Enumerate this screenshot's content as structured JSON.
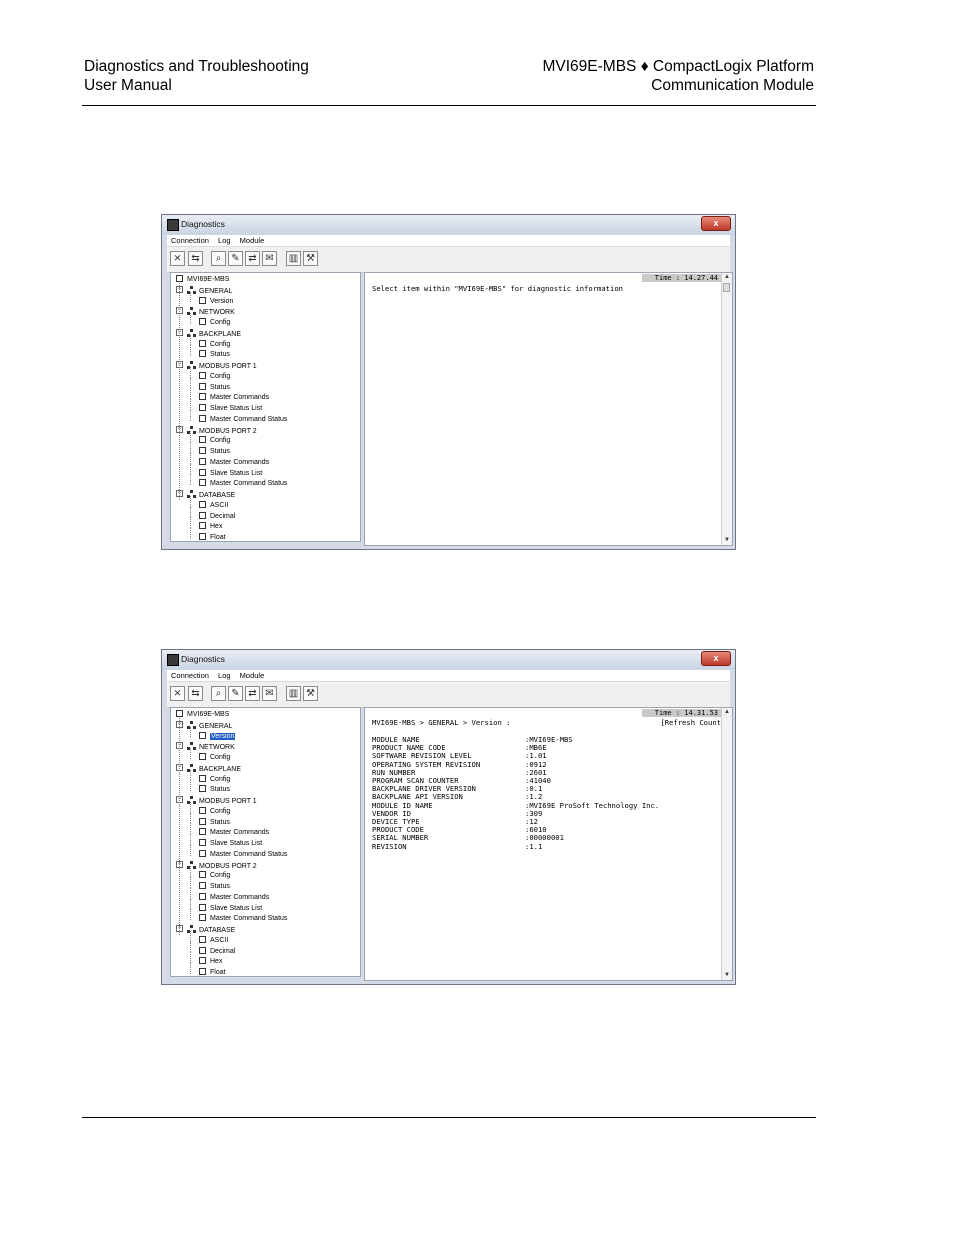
{
  "header": {
    "left_line1": "Diagnostics and Troubleshooting",
    "left_line2": "User Manual",
    "right_line1": "MVI69E-MBS ♦ CompactLogix Platform",
    "right_line2": "Communication Module"
  },
  "window": {
    "title": "Diagnostics",
    "close_symbol": "x",
    "menu": [
      "Connection",
      "Log",
      "Module"
    ]
  },
  "toolbar_icons": [
    "disconnect-icon",
    "connect-icon",
    "zoom-icon",
    "edit-icon",
    "transfer-icon",
    "mail-icon",
    "chart-icon",
    "tools-icon"
  ],
  "tree": [
    {
      "label": "MVI69E-MBS",
      "level": 0,
      "kind": "root"
    },
    {
      "label": "GENERAL",
      "level": 1,
      "kind": "group"
    },
    {
      "label": "Version",
      "level": 2,
      "kind": "leaf"
    },
    {
      "label": "NETWORK",
      "level": 1,
      "kind": "group"
    },
    {
      "label": "Config",
      "level": 2,
      "kind": "leaf"
    },
    {
      "label": "BACKPLANE",
      "level": 1,
      "kind": "group"
    },
    {
      "label": "Config",
      "level": 2,
      "kind": "leaf"
    },
    {
      "label": "Status",
      "level": 2,
      "kind": "leaf"
    },
    {
      "label": "MODBUS PORT 1",
      "level": 1,
      "kind": "group"
    },
    {
      "label": "Config",
      "level": 2,
      "kind": "leaf"
    },
    {
      "label": "Status",
      "level": 2,
      "kind": "leaf"
    },
    {
      "label": "Master Commands",
      "level": 2,
      "kind": "leaf"
    },
    {
      "label": "Slave Status List",
      "level": 2,
      "kind": "leaf"
    },
    {
      "label": "Master Command Status",
      "level": 2,
      "kind": "leaf"
    },
    {
      "label": "MODBUS PORT 2",
      "level": 1,
      "kind": "group"
    },
    {
      "label": "Config",
      "level": 2,
      "kind": "leaf"
    },
    {
      "label": "Status",
      "level": 2,
      "kind": "leaf"
    },
    {
      "label": "Master Commands",
      "level": 2,
      "kind": "leaf"
    },
    {
      "label": "Slave Status List",
      "level": 2,
      "kind": "leaf"
    },
    {
      "label": "Master Command Status",
      "level": 2,
      "kind": "leaf"
    },
    {
      "label": "DATABASE",
      "level": 1,
      "kind": "group"
    },
    {
      "label": "ASCII",
      "level": 2,
      "kind": "leaf"
    },
    {
      "label": "Decimal",
      "level": 2,
      "kind": "leaf"
    },
    {
      "label": "Hex",
      "level": 2,
      "kind": "leaf"
    },
    {
      "label": "Float",
      "level": 2,
      "kind": "leaf"
    }
  ],
  "screen1": {
    "time": "Time : 14.27.44",
    "message": "Select item within \"MVI69E-MBS\" for diagnostic information"
  },
  "screen2": {
    "time": "Time : 14.31.53",
    "selected_index": 2,
    "path": "MVI69E-MBS > GENERAL > Version :",
    "refresh": "[Refresh Count",
    "rows": [
      {
        "k": "MODULE NAME",
        "v": ":MVI69E-MBS"
      },
      {
        "k": "PRODUCT NAME CODE",
        "v": ":MB6E"
      },
      {
        "k": "SOFTWARE REVISION LEVEL",
        "v": ":1.01"
      },
      {
        "k": "OPERATING SYSTEM REVISION",
        "v": ":0912"
      },
      {
        "k": "RUN NUMBER",
        "v": ":2601"
      },
      {
        "k": "PROGRAM SCAN COUNTER",
        "v": ":41040"
      },
      {
        "k": "BACKPLANE DRIVER VERSION",
        "v": ":0.1"
      },
      {
        "k": "BACKPLANE API VERSION",
        "v": ":1.2"
      },
      {
        "k": "MODULE ID NAME",
        "v": ":MVI69E ProSoft Technology Inc."
      },
      {
        "k": "VENDOR ID",
        "v": ":309"
      },
      {
        "k": "DEVICE TYPE",
        "v": ":12"
      },
      {
        "k": "PRODUCT CODE",
        "v": ":6010"
      },
      {
        "k": "SERIAL NUMBER",
        "v": ":00000001"
      },
      {
        "k": "REVISION",
        "v": ":1.1"
      }
    ]
  },
  "colors": {
    "selection": "#1f5cc4",
    "window_frame": "#d4dbe6",
    "close_button": "#c0392b"
  }
}
